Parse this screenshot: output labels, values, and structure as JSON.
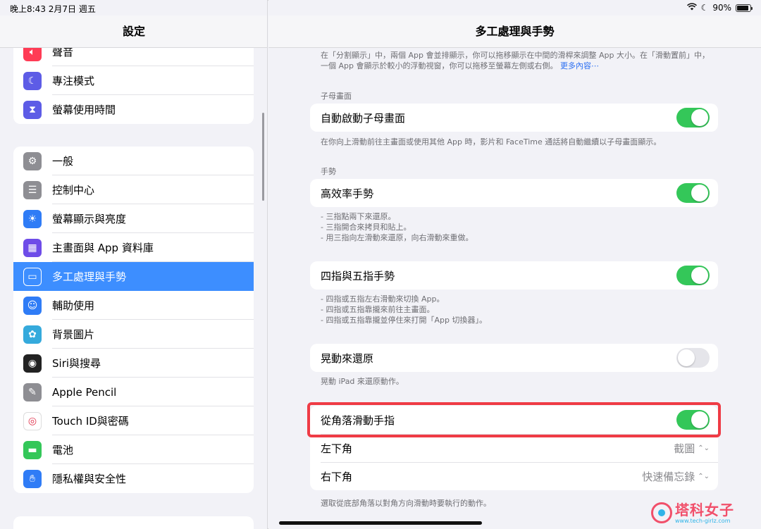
{
  "status_bar": {
    "time": "晚上8:43 2月7日 週五",
    "battery": "90%",
    "battery_level": 0.9
  },
  "sidebar": {
    "title": "設定",
    "group1": [
      {
        "label": "聲音",
        "icon": "speaker-icon",
        "color": "#ff3b55"
      },
      {
        "label": "專注模式",
        "icon": "moon-icon",
        "color": "#5d5ce6"
      },
      {
        "label": "螢幕使用時間",
        "icon": "hourglass-icon",
        "color": "#5d5ce6"
      }
    ],
    "group2": [
      {
        "label": "一般",
        "icon": "gear-icon",
        "color": "#8e8e93"
      },
      {
        "label": "控制中心",
        "icon": "switches-icon",
        "color": "#8e8e93"
      },
      {
        "label": "螢幕顯示與亮度",
        "icon": "sun-icon",
        "color": "#2f7cf6"
      },
      {
        "label": "主畫面與 App 資料庫",
        "icon": "grid-icon",
        "color": "#6e4ce8"
      },
      {
        "label": "多工處理與手勢",
        "icon": "multitask-icon",
        "color": "#2f7cf6",
        "selected": true
      },
      {
        "label": "輔助使用",
        "icon": "accessibility-icon",
        "color": "#2f7cf6"
      },
      {
        "label": "背景圖片",
        "icon": "flower-icon",
        "color": "#35aadc"
      },
      {
        "label": "Siri與搜尋",
        "icon": "siri-icon",
        "color": "#222222"
      },
      {
        "label": "Apple Pencil",
        "icon": "pencil-icon",
        "color": "#8e8e93"
      },
      {
        "label": "Touch ID與密碼",
        "icon": "fingerprint-icon",
        "color": "#ffffff"
      },
      {
        "label": "電池",
        "icon": "battery-icon",
        "color": "#34c759"
      },
      {
        "label": "隱私權與安全性",
        "icon": "hand-icon",
        "color": "#2f7cf6"
      }
    ]
  },
  "detail": {
    "title": "多工處理與手勢",
    "intro": "在「分割顯示」中，兩個 App 會並排顯示，你可以拖移顯示在中間的滑桿來調整 App 大小。在「滑動置前」中，一個 App 會顯示於較小的浮動視窗，你可以拖移至螢幕左側或右側。",
    "intro_more": "更多內容⋯",
    "pip_section": "子母畫面",
    "pip_label": "自動啟動子母畫面",
    "pip_on": true,
    "pip_desc": "在你向上滑動前往主畫面或使用其他 App 時，影片和 FaceTime 通話將自動繼續以子母畫面顯示。",
    "gesture_section": "手勢",
    "efficient_label": "高效率手勢",
    "efficient_on": true,
    "efficient_desc": [
      "- 三指點兩下來還原。",
      "- 三指開合來拷貝和貼上。",
      "- 用三指向左滑動來還原，向右滑動來重做。"
    ],
    "fourfive_label": "四指與五指手勢",
    "fourfive_on": true,
    "fourfive_desc": [
      "- 四指或五指左右滑動來切換 App。",
      "- 四指或五指靠攏來前往主畫面。",
      "- 四指或五指靠攏並停住來打開「App 切換器」。"
    ],
    "shake_label": "晃動來還原",
    "shake_on": false,
    "shake_desc": "晃動 iPad 來還原動作。",
    "corner_label": "從角落滑動手指",
    "corner_on": true,
    "left_corner_label": "左下角",
    "left_corner_value": "截圖",
    "right_corner_label": "右下角",
    "right_corner_value": "快速備忘錄",
    "corner_desc": "選取從底部角落以對角方向滑動時要執行的動作。"
  },
  "watermark": {
    "text": "塔科女子",
    "url": "www.tech-girlz.com"
  },
  "colors": {
    "accent": "#3d8eff",
    "toggle_on": "#34c759",
    "highlight": "#ef3b45"
  }
}
